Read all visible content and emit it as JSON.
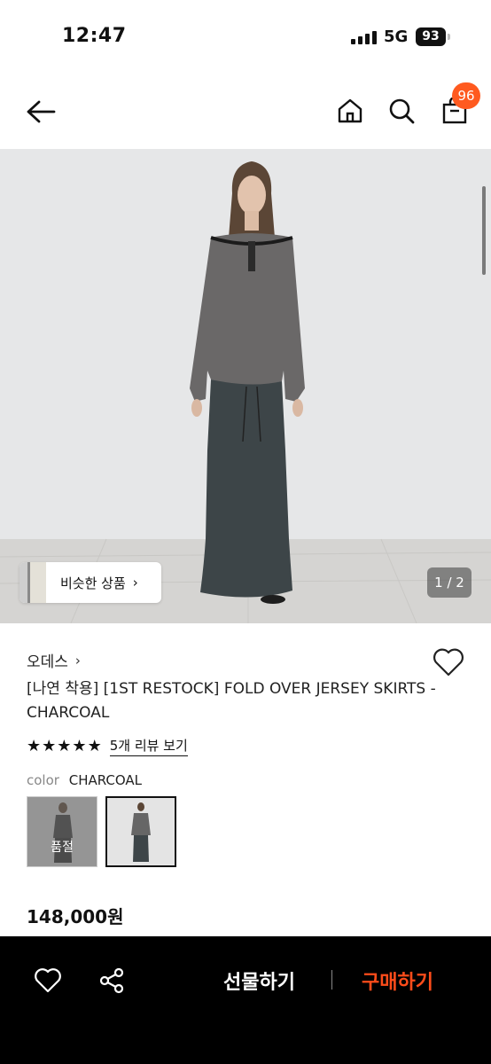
{
  "status_bar": {
    "time": "12:47",
    "network": "5G",
    "battery": "93"
  },
  "header": {
    "cart_count": "96"
  },
  "gallery": {
    "similar_label": "비슷한 상품",
    "page_indicator": "1 / 2"
  },
  "product": {
    "brand": "오데스",
    "title": "[나연 착용] [1ST RESTOCK] FOLD OVER JERSEY SKIRTS - CHARCOAL",
    "rating_stars": 5,
    "review_link": "5개 리뷰 보기",
    "color_key": "color",
    "color_value": "CHARCOAL",
    "swatches": [
      {
        "sold_out_label": "품절",
        "selected": false
      },
      {
        "selected": true
      }
    ],
    "price": "148,000원"
  },
  "bottom_bar": {
    "gift_label": "선물하기",
    "buy_label": "구매하기",
    "buy_color": "#ff4c1a"
  },
  "colors": {
    "accent": "#ff5a1f",
    "bar_bg": "#000000"
  }
}
